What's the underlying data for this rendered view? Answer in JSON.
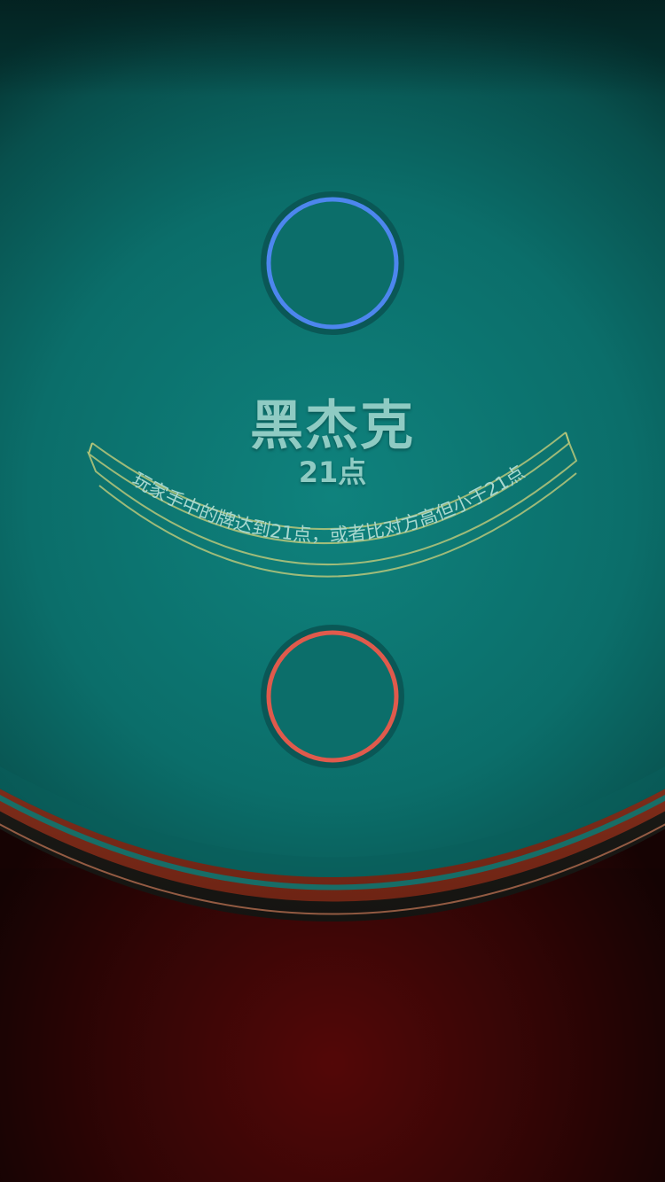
{
  "game": {
    "title": "黑杰克",
    "subtitle": "21点",
    "rule_banner": "玩家手中的牌达到21点，或者比对方高但小于21点"
  },
  "seats": [
    {
      "name": "dealer-seat",
      "ring_color": "#4d86ee"
    },
    {
      "name": "player-seat",
      "ring_color": "#e05a4c"
    }
  ],
  "colors": {
    "felt_light": "#0e7f7a",
    "felt_dark": "#07413f",
    "banner_line": "#b8c77a",
    "banner_text": "#a8d8cf",
    "wood_rim": "#b04a30",
    "floor_red": "#6a0b0b"
  }
}
